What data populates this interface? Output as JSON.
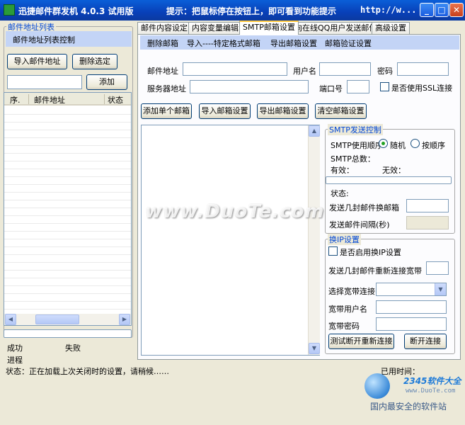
{
  "titlebar": {
    "title": "迅捷邮件群发机 4.0.3 试用版",
    "hint": "提示：把鼠标停在按钮上，即可看到功能提示",
    "url": "http://w...",
    "min": "_",
    "max": "□",
    "close": "✕"
  },
  "left": {
    "group_title": "邮件地址列表",
    "panel_label": "邮件地址列表控制",
    "import_btn": "导入邮件地址",
    "delete_btn": "删除选定",
    "add_input": "",
    "add_btn": "添加",
    "columns": [
      "序.",
      "邮件地址",
      "状态"
    ],
    "success_label": "成功",
    "fail_label": "失败",
    "progress_label": "进程"
  },
  "tabs": [
    {
      "label": "邮件内容设定"
    },
    {
      "label": "内容变量编辑"
    },
    {
      "label": "SMTP邮箱设置"
    },
    {
      "label": "向在线QQ用户发送邮件"
    },
    {
      "label": "高级设置"
    }
  ],
  "subbar": {
    "items": [
      "删除邮箱",
      "导入----特定格式邮箱",
      "导出邮箱设置",
      "邮箱验证设置"
    ]
  },
  "form": {
    "email_label": "邮件地址",
    "user_label": "用户名",
    "pwd_label": "密码",
    "server_label": "服务器地址",
    "port_label": "端口号",
    "ssl_label": "是否使用SSL连接"
  },
  "actions": {
    "add_single": "添加单个邮箱",
    "import_settings": "导入邮箱设置",
    "export_settings": "导出邮箱设置",
    "clear_settings": "清空邮箱设置"
  },
  "smtp": {
    "title": "SMTP发送控制",
    "order_label": "SMTP使用顺序",
    "random": "随机",
    "sequential": "按顺序",
    "total_label": "SMTP总数：",
    "valid_label": "有效：",
    "invalid_label": "无效：",
    "status_label": "状态:",
    "switch_label": "发送几封邮件换邮箱",
    "interval_label": "发送邮件间隔(秒)"
  },
  "ip": {
    "title": "换IP设置",
    "enable_label": "是否启用换IP设置",
    "reconnect_label": "发送几封邮件重新连接宽带",
    "select_label": "选择宽带连接",
    "user_label": "宽带用户名",
    "pwd_label": "宽带密码",
    "test_btn": "测试断开重新连接",
    "disconnect_btn": "断开连接"
  },
  "status": {
    "text": "状态：正在加载上次关闭时的设置，请稍候……",
    "elapsed_label": "已用时间："
  },
  "watermark": "www.DuoTe.com",
  "brand": {
    "name": "2345软件大全",
    "url": "www.DuoTe.com",
    "slogan": "国内最安全的软件站"
  }
}
